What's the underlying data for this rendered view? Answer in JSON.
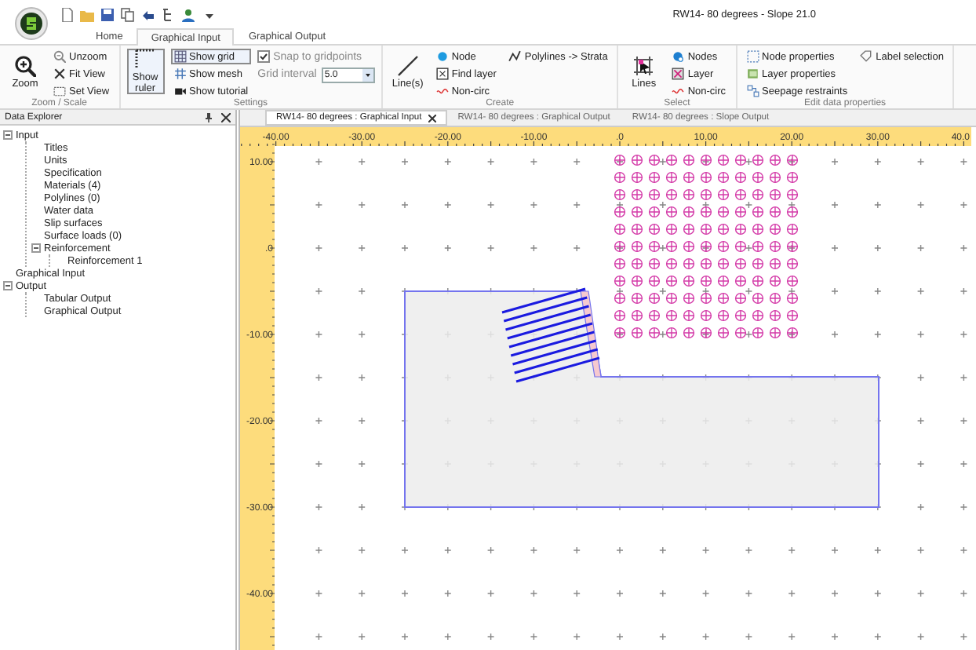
{
  "window": {
    "title": "RW14- 80 degrees - Slope 21.0"
  },
  "ribbon_tabs": [
    {
      "label": "Home",
      "selected": false
    },
    {
      "label": "Graphical Input",
      "selected": true
    },
    {
      "label": "Graphical Output",
      "selected": false
    }
  ],
  "ribbon_groups": [
    {
      "caption": "Zoom / Scale",
      "columns": [
        [
          {
            "label": "Zoom",
            "kind": "large",
            "pressed": false
          }
        ],
        [
          {
            "label": "Unzoom",
            "kind": "small",
            "pressed": false
          },
          {
            "label": "Fit View",
            "kind": "small",
            "pressed": false
          },
          {
            "label": "Set View",
            "kind": "small",
            "pressed": false
          }
        ]
      ]
    },
    {
      "caption": "Settings",
      "columns": [
        [
          {
            "label": "Show ruler",
            "kind": "large",
            "pressed": true
          }
        ],
        [
          {
            "label": "Show grid",
            "kind": "small",
            "pressed": true
          },
          {
            "label": "Show mesh",
            "kind": "small",
            "pressed": false
          },
          {
            "label": "Show tutorial",
            "kind": "small",
            "pressed": false
          }
        ],
        [
          {
            "label": "Snap to gridpoints",
            "kind": "check",
            "checked": true
          },
          {
            "label": "Grid interval",
            "kind": "dropdown",
            "value": "5.0"
          }
        ]
      ]
    },
    {
      "caption": "Create",
      "columns": [
        [
          {
            "label": "Line(s)",
            "kind": "large",
            "pressed": false
          }
        ],
        [
          {
            "label": "Node",
            "kind": "small",
            "pressed": false
          },
          {
            "label": "Find layer",
            "kind": "small",
            "pressed": false
          },
          {
            "label": "Non-circ",
            "kind": "small",
            "pressed": false
          }
        ],
        [
          {
            "label": "Polylines -> Strata",
            "kind": "small",
            "pressed": false
          }
        ]
      ]
    },
    {
      "caption": "Select",
      "columns": [
        [
          {
            "label": "Lines",
            "kind": "large",
            "pressed": false
          }
        ],
        [
          {
            "label": "Nodes",
            "kind": "small",
            "pressed": false
          },
          {
            "label": "Layer",
            "kind": "small",
            "pressed": false
          },
          {
            "label": "Non-circ",
            "kind": "small",
            "pressed": false
          }
        ]
      ]
    },
    {
      "caption": "Edit data properties",
      "columns": [
        [
          {
            "label": "Node properties",
            "kind": "small",
            "pressed": false
          },
          {
            "label": "Layer properties",
            "kind": "small",
            "pressed": false
          },
          {
            "label": "Seepage restraints",
            "kind": "small",
            "pressed": false
          }
        ],
        [
          {
            "label": "Label selection",
            "kind": "small",
            "pressed": false
          }
        ]
      ]
    }
  ],
  "data_explorer": {
    "title": "Data Explorer",
    "tree": [
      {
        "label": "Input",
        "expanded": true,
        "children": [
          {
            "label": "Titles"
          },
          {
            "label": "Units"
          },
          {
            "label": "Specification"
          },
          {
            "label": "Materials (4)"
          },
          {
            "label": "Polylines (0)"
          },
          {
            "label": "Water data"
          },
          {
            "label": "Slip surfaces"
          },
          {
            "label": "Surface loads (0)"
          },
          {
            "label": "Reinforcement",
            "expanded": true,
            "children": [
              {
                "label": "Reinforcement 1"
              }
            ]
          }
        ]
      },
      {
        "label": "Graphical Input"
      },
      {
        "label": "Output",
        "expanded": true,
        "children": [
          {
            "label": "Tabular Output"
          },
          {
            "label": "Graphical Output"
          }
        ]
      }
    ]
  },
  "doc_tabs": [
    {
      "label": "RW14- 80 degrees : Graphical Input",
      "selected": true
    },
    {
      "label": "RW14- 80 degrees : Graphical Output",
      "selected": false
    },
    {
      "label": "RW14- 80 degrees : Slope Output",
      "selected": false
    }
  ],
  "canvas": {
    "x_ruler_labels": [
      "-40.00",
      "-30.00",
      "-20.00",
      "-10.00",
      ".0",
      "10.00",
      "20.00",
      "30.00",
      "40.0"
    ],
    "y_ruler_labels": [
      "10.00",
      ".0",
      "-10.00",
      "-20.00",
      "-30.00",
      "-40.00"
    ]
  }
}
